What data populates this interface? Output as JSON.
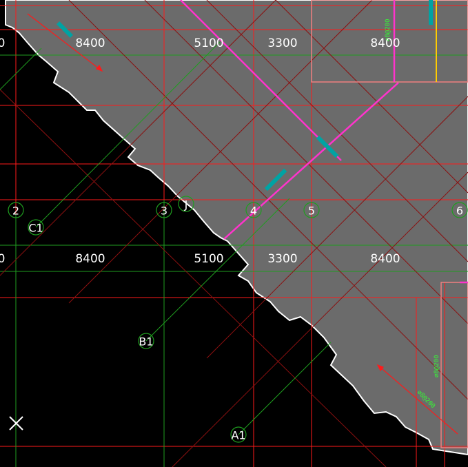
{
  "colors": {
    "background": "#000000",
    "slab": "#6b6b6b",
    "slab_edge": "#ffffff",
    "axis_red": "#ff1a1a",
    "axis_dark_red": "#8b1010",
    "dim_green": "#1f9e1f",
    "rebar_magenta": "#ff33cc",
    "rebar_teal": "#00a3a3",
    "rebar_green": "#33ff33",
    "note_yellow": "#ffcc00",
    "pink_outline": "#f08080"
  },
  "dimensions": {
    "upper_row": [
      "0",
      "8400",
      "5100",
      "3300",
      "8400"
    ],
    "lower_row": [
      "0",
      "8400",
      "5100",
      "3300",
      "8400"
    ]
  },
  "grid_axes": {
    "numbered": [
      "2",
      "3",
      "4",
      "5",
      "6"
    ],
    "lettered": [
      "C1",
      "J",
      "B1",
      "A1"
    ]
  },
  "rebar_tags": {
    "vertical_top": "⌀8@200",
    "vertical_bottom": "⌀8@200",
    "green_bottom": "⌀8@200"
  },
  "icons": [
    "close-icon"
  ]
}
